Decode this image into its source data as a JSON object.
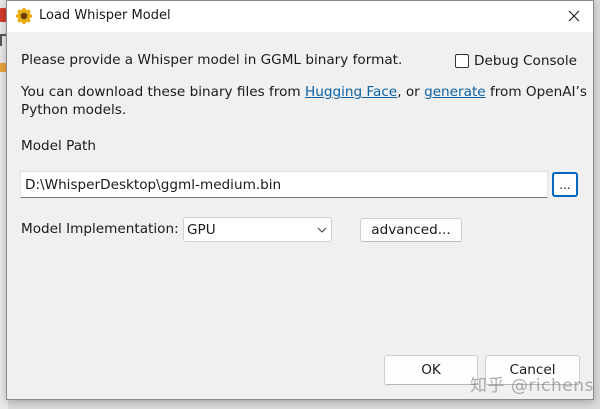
{
  "window": {
    "title": "Load Whisper Model",
    "icon": "sunflower-icon",
    "close_glyph": "✕"
  },
  "intro": {
    "text": "Please provide a Whisper model in GGML binary format."
  },
  "debug_console": {
    "label": "Debug Console",
    "checked": false
  },
  "download": {
    "line1_prefix": "You can download these binary files from ",
    "link1": "Hugging Face",
    "middle": ", or ",
    "link2": "generate",
    "line1_suffix": " from OpenAI’s",
    "line2": "Python models."
  },
  "model_path": {
    "label": "Model Path",
    "value": "D:\\WhisperDesktop\\ggml-medium.bin",
    "browse_label": "..."
  },
  "implementation": {
    "label": "Model Implementation:",
    "selected": "GPU",
    "advanced_label": "advanced..."
  },
  "buttons": {
    "ok": "OK",
    "cancel": "Cancel"
  },
  "watermark": "知乎 @richens",
  "colors": {
    "link": "#0b61a4",
    "focus_border": "#0067c0",
    "dialog_bg": "#f0f0f0"
  }
}
